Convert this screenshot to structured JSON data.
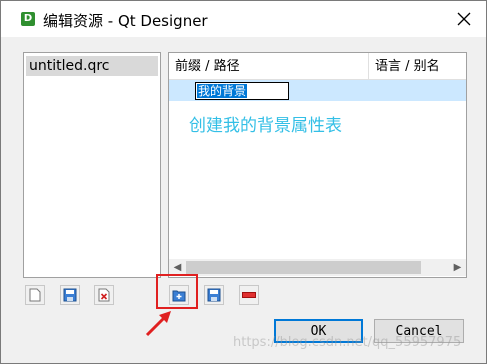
{
  "window": {
    "title": "编辑资源 - Qt Designer",
    "app_icon_letter": "D"
  },
  "file_list": {
    "items": [
      "untitled.qrc"
    ]
  },
  "tree": {
    "headers": [
      "前缀 / 路径",
      "语言 / 别名"
    ],
    "editing_value": "我的背景"
  },
  "annotation": {
    "caption": "创建我的背景属性表",
    "highlight_color": "#e02020"
  },
  "toolbar": {
    "left_icons": [
      "new-file-icon",
      "save-icon",
      "remove-file-icon"
    ],
    "right_icons": [
      "add-prefix-icon",
      "add-files-icon",
      "remove-icon"
    ]
  },
  "buttons": {
    "ok": "OK",
    "cancel": "Cancel"
  },
  "watermark": "https://blog.csdn.net/qq_55957975"
}
